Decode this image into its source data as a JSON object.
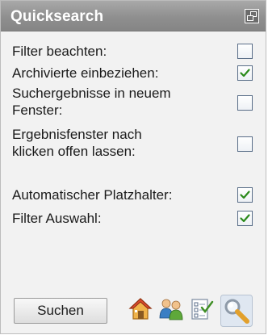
{
  "panel": {
    "title": "Quicksearch",
    "header_icon": "undock-window-icon"
  },
  "options": [
    {
      "label": "Filter beachten:",
      "checked": false
    },
    {
      "label": "Archivierte einbeziehen:",
      "checked": true
    },
    {
      "label": "Suchergebnisse in neuem",
      "label2": "Fenster:",
      "checked": false
    },
    {
      "label": "Ergebnisfenster nach",
      "label2": "klicken offen lassen:",
      "checked": false
    },
    {
      "label": "Automatischer Platzhalter:",
      "checked": true
    },
    {
      "label": "Filter Auswahl:",
      "checked": true
    }
  ],
  "footer": {
    "search_label": "Suchen",
    "icons": [
      "home-icon",
      "users-icon",
      "checklist-icon",
      "search-magnifier-icon"
    ]
  },
  "colors": {
    "header": "#8f8f8f",
    "panel_bg": "#f2f2f2",
    "check": "#2a8a1a"
  }
}
